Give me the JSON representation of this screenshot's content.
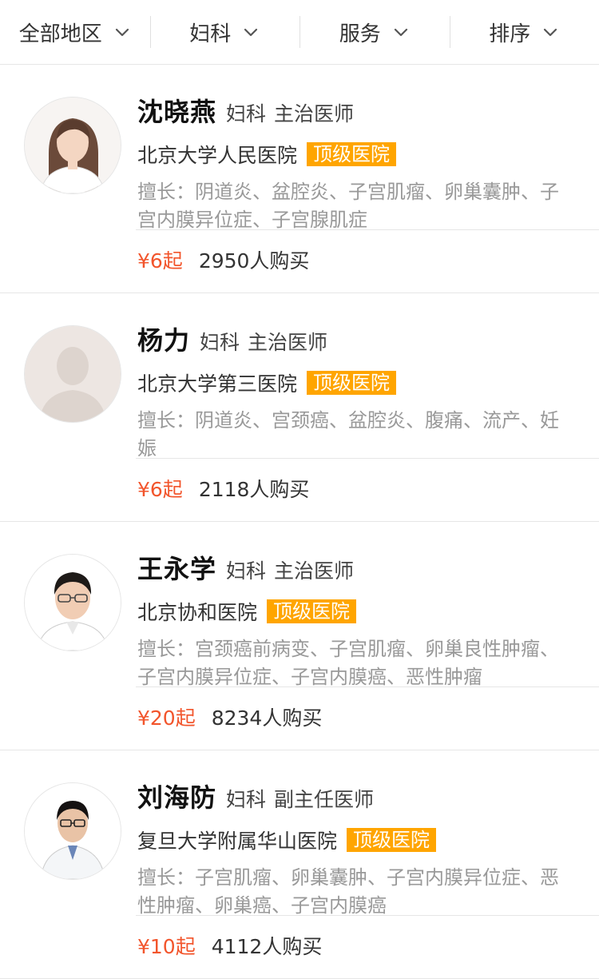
{
  "filters": [
    {
      "label": "全部地区"
    },
    {
      "label": "妇科"
    },
    {
      "label": "服务"
    },
    {
      "label": "排序"
    }
  ],
  "doctors": [
    {
      "name": "沈晓燕",
      "department": "妇科",
      "title": "主治医师",
      "hospital": "北京大学人民医院",
      "badge": "顶级医院",
      "skills": "擅长：阴道炎、盆腔炎、子宫肌瘤、卵巢囊肿、子宫内膜异位症、子宫腺肌症",
      "price": "¥6起",
      "buyers": "2950人购买",
      "avatar": "female-doctor-photo"
    },
    {
      "name": "杨力",
      "department": "妇科",
      "title": "主治医师",
      "hospital": "北京大学第三医院",
      "badge": "顶级医院",
      "skills": "擅长：阴道炎、宫颈癌、盆腔炎、腹痛、流产、妊娠",
      "price": "¥6起",
      "buyers": "2118人购买",
      "avatar": "default-avatar-placeholder"
    },
    {
      "name": "王永学",
      "department": "妇科",
      "title": "主治医师",
      "hospital": "北京协和医院",
      "badge": "顶级医院",
      "skills": "擅长：宫颈癌前病变、子宫肌瘤、卵巢良性肿瘤、子宫内膜异位症、子宫内膜癌、恶性肿瘤",
      "price": "¥20起",
      "buyers": "8234人购买",
      "avatar": "male-doctor-photo"
    },
    {
      "name": "刘海防",
      "department": "妇科",
      "title": "副主任医师",
      "hospital": "复旦大学附属华山医院",
      "badge": "顶级医院",
      "skills": "擅长：子宫肌瘤、卵巢囊肿、子宫内膜异位症、恶性肿瘤、卵巢癌、子宫内膜癌",
      "price": "¥10起",
      "buyers": "4112人购买",
      "avatar": "male-doctor-photo"
    }
  ],
  "colors": {
    "price": "#f2552c",
    "badge_bg": "#ffa500",
    "skills_text": "#999999"
  }
}
